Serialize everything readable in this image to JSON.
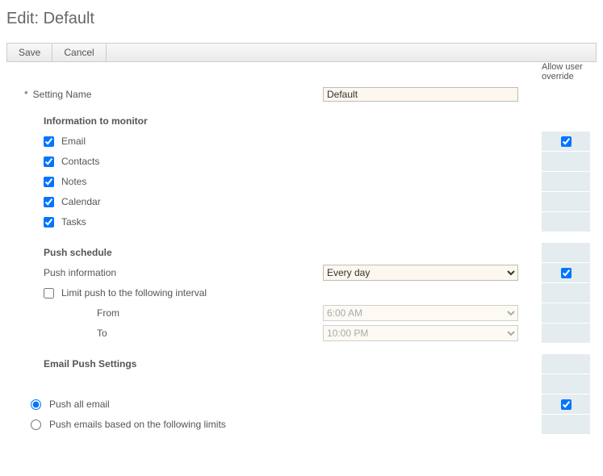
{
  "page": {
    "title": "Edit: Default"
  },
  "toolbar": {
    "save": "Save",
    "cancel": "Cancel"
  },
  "override_header": "Allow user override",
  "setting_name": {
    "label": "Setting Name",
    "value": "Default",
    "required_marker": "*"
  },
  "sections": {
    "monitor": {
      "heading": "Information to monitor",
      "items": {
        "email": {
          "label": "Email",
          "checked": true
        },
        "contacts": {
          "label": "Contacts",
          "checked": true
        },
        "notes": {
          "label": "Notes",
          "checked": true
        },
        "calendar": {
          "label": "Calendar",
          "checked": true
        },
        "tasks": {
          "label": "Tasks",
          "checked": true
        }
      },
      "override_checked": true
    },
    "push": {
      "heading": "Push schedule",
      "push_info_label": "Push information",
      "push_info_value": "Every day",
      "limit": {
        "label": "Limit push to the following interval",
        "checked": false
      },
      "from": {
        "label": "From",
        "value": "6:00 AM"
      },
      "to": {
        "label": "To",
        "value": "10:00 PM"
      },
      "override_checked": true
    },
    "email_push": {
      "heading": "Email Push Settings",
      "options": {
        "all": {
          "label": "Push all email",
          "selected": true
        },
        "limits": {
          "label": "Push emails based on the following limits",
          "selected": false
        }
      },
      "override_checked": true
    }
  }
}
